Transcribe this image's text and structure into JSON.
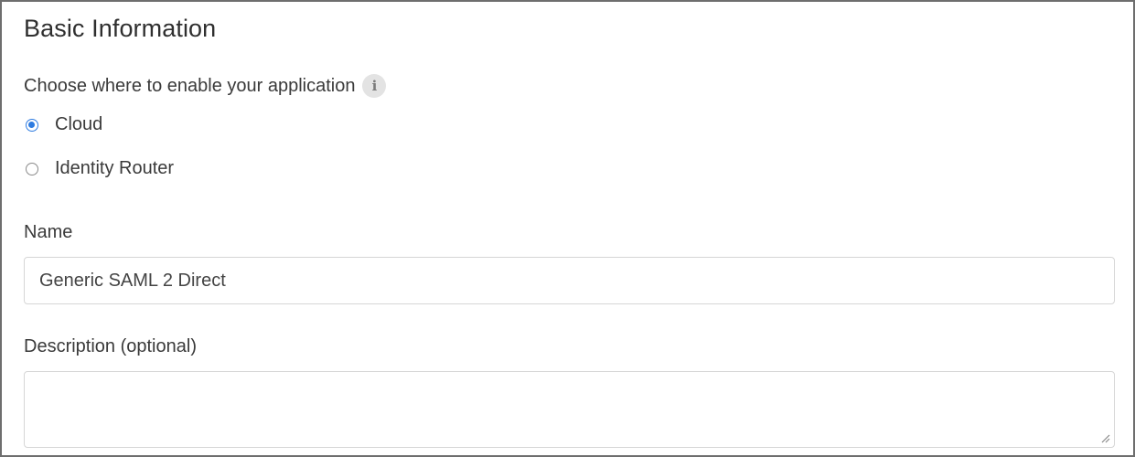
{
  "section": {
    "title": "Basic Information"
  },
  "enable_location": {
    "prompt": "Choose where to enable your application",
    "info_icon": "info-icon",
    "options": [
      {
        "label": "Cloud",
        "selected": true
      },
      {
        "label": "Identity Router",
        "selected": false
      }
    ]
  },
  "name_field": {
    "label": "Name",
    "value": "Generic SAML 2 Direct"
  },
  "description_field": {
    "label": "Description (optional)",
    "value": ""
  },
  "colors": {
    "accent": "#2d7be0",
    "border": "#d6d6d6",
    "panel_border": "#6e6e6e",
    "text": "#3a3a3a"
  }
}
